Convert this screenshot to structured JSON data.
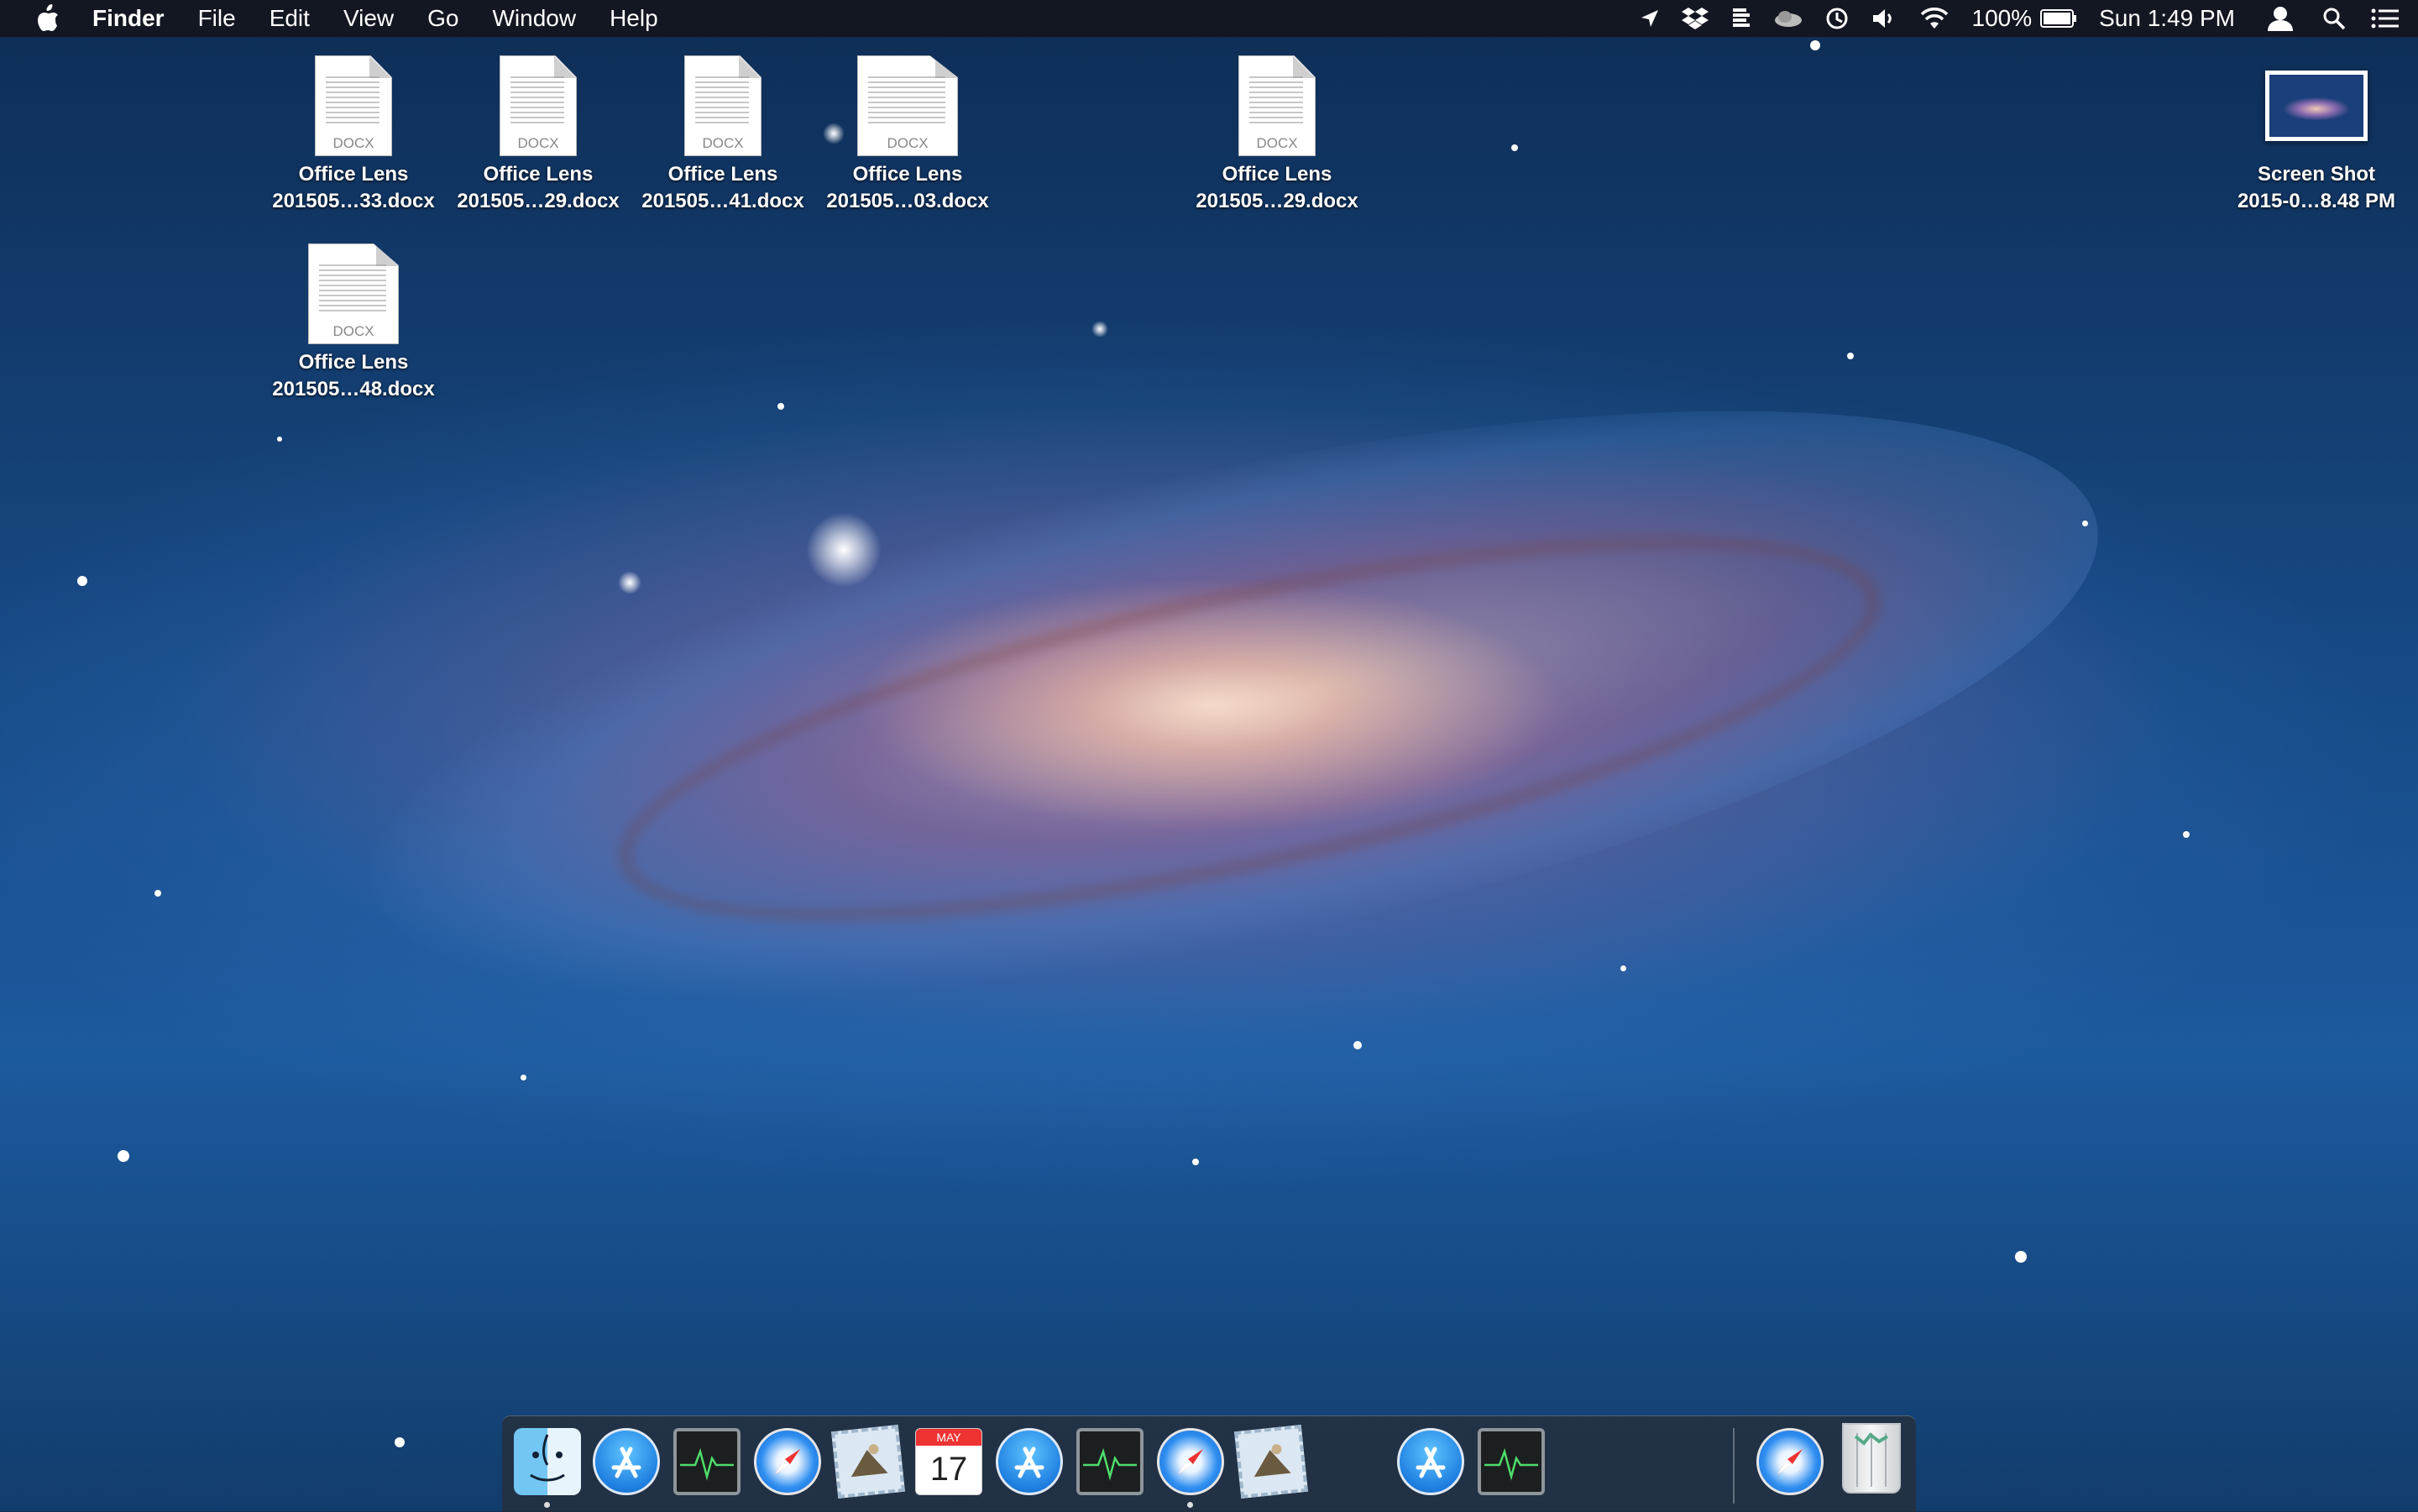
{
  "menubar": {
    "app_name": "Finder",
    "menus": [
      "File",
      "Edit",
      "View",
      "Go",
      "Window",
      "Help"
    ],
    "status": {
      "battery_percent": "100%",
      "clock": "Sun 1:49 PM",
      "icons": [
        "location-arrow-icon",
        "dropbox-icon",
        "evernote-icon",
        "cloud-icon",
        "timemachine-icon",
        "volume-icon",
        "wifi-icon",
        "battery-icon",
        "user-icon",
        "spotlight-icon",
        "notification-center-icon"
      ]
    }
  },
  "desktop": {
    "files": [
      {
        "kind": "DOCX",
        "line1": "Office Lens",
        "line2": "201505…33.docx"
      },
      {
        "kind": "DOCX",
        "line1": "Office Lens",
        "line2": "201505…29.docx"
      },
      {
        "kind": "DOCX",
        "line1": "Office Lens",
        "line2": "201505…41.docx"
      },
      {
        "kind": "DOCX",
        "line1": "Office Lens",
        "line2": "201505…03.docx"
      },
      {
        "kind": "DOCX",
        "line1": "Office Lens",
        "line2": "201505…29.docx"
      },
      {
        "kind": "DOCX",
        "line1": "Office Lens",
        "line2": "201505…48.docx"
      },
      {
        "kind": "screenshot",
        "line1": "Screen Shot",
        "line2": "2015-0…8.48 PM"
      }
    ]
  },
  "dock": {
    "items": [
      "finder-icon",
      "app-store-icon",
      "activity-monitor-icon",
      "safari-icon",
      "mail-icon",
      "calendar-icon",
      "app-store-icon",
      "activity-monitor-icon",
      "safari-icon",
      "mail-icon",
      "app-store-icon",
      "activity-monitor-icon",
      "safari-icon",
      "trash-icon"
    ],
    "calendar": {
      "month": "MAY",
      "day": "17"
    }
  }
}
